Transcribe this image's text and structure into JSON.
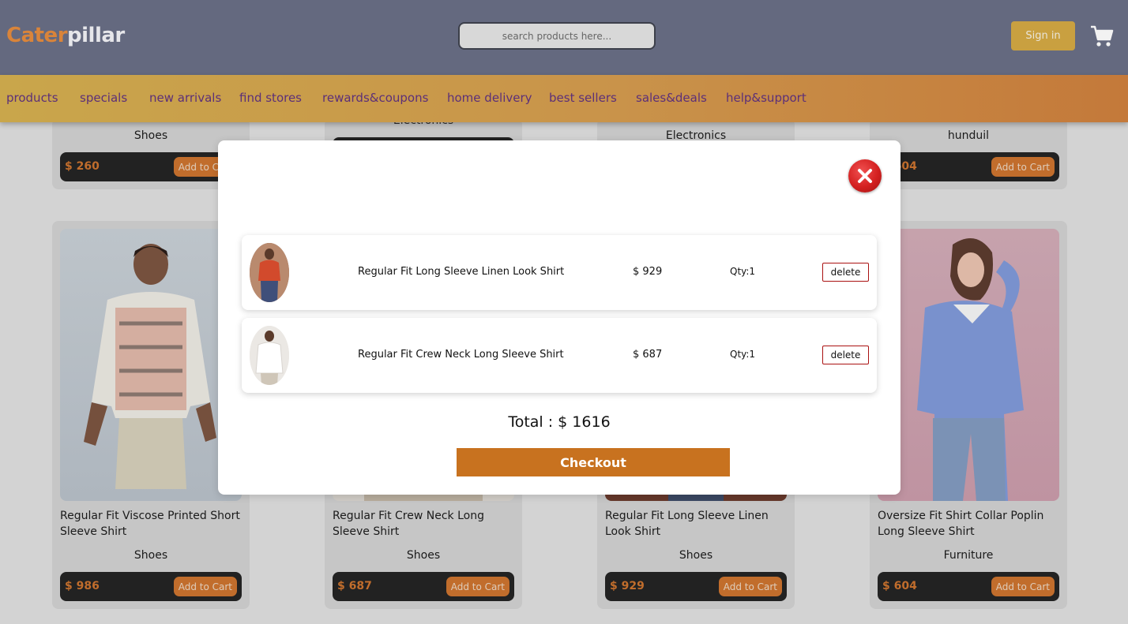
{
  "header": {
    "logo_part1": "Cater",
    "logo_part2": "pillar",
    "search_placeholder": "search products here...",
    "signin_label": "Sign in",
    "cart_icon": "cart-icon"
  },
  "nav": {
    "items": [
      "products",
      "specials",
      "new arrivals",
      "find stores",
      "rewards&coupons",
      "home delivery",
      "best sellers",
      "sales&deals",
      "help&support"
    ]
  },
  "top_row": [
    {
      "category": "Shoes",
      "price": "$ 260",
      "add_label": "Add to Cart"
    },
    {
      "category": "Electronics"
    },
    {
      "category": "Electronics"
    },
    {
      "category": "hunduil",
      "price": "$ 604",
      "add_label": "Add to Cart"
    }
  ],
  "products": [
    {
      "name": "Regular Fit Viscose Printed Short Sleeve Shirt",
      "category": "Shoes",
      "price": "$ 986",
      "add_label": "Add to Cart"
    },
    {
      "name": "Regular Fit Crew Neck Long Sleeve Shirt",
      "category": "Shoes",
      "price": "$ 687",
      "add_label": "Add to Cart"
    },
    {
      "name": "Regular Fit Long Sleeve Linen Look Shirt",
      "category": "Shoes",
      "price": "$ 929",
      "add_label": "Add to Cart"
    },
    {
      "name": "Oversize Fit Shirt Collar Poplin Long Sleeve Shirt",
      "category": "Furniture",
      "price": "$ 604",
      "add_label": "Add to Cart"
    }
  ],
  "cart_modal": {
    "items": [
      {
        "title": "Regular Fit Long Sleeve Linen Look Shirt",
        "price": "$ 929",
        "qty": "Qty:1",
        "delete_label": "delete"
      },
      {
        "title": "Regular Fit Crew Neck Long Sleeve Shirt",
        "price": "$ 687",
        "qty": "Qty:1",
        "delete_label": "delete"
      }
    ],
    "total": "Total : $ 1616",
    "checkout_label": "Checkout"
  },
  "colors": {
    "header_bg": "#64697f",
    "accent": "#c8721f",
    "nav_text": "#5c2f78"
  }
}
